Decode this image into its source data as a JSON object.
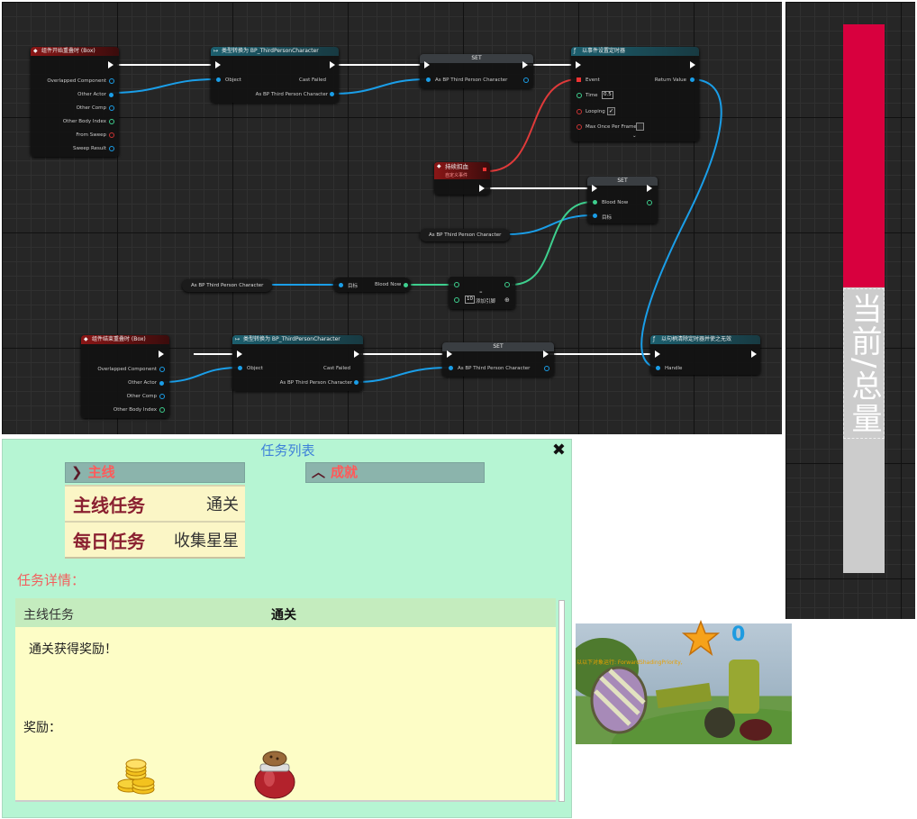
{
  "blueprint": {
    "begin_overlap": {
      "title": "组件开始重叠时 (Box)",
      "pins": [
        "Overlapped Component",
        "Other Actor",
        "Other Comp",
        "Other Body Index",
        "From Sweep",
        "Sweep Result"
      ]
    },
    "cast1": {
      "title": "类型转换为 BP_ThirdPersonCharacter",
      "object": "Object",
      "cast_failed": "Cast Failed",
      "as_bp": "As BP Third Person Character"
    },
    "set1": {
      "title": "SET",
      "pin": "As BP Third Person Character"
    },
    "set_timer": {
      "title": "以事件设置定时器",
      "event": "Event",
      "return_value": "Return Value",
      "time_label": "Time",
      "time_value": "0.5",
      "looping": "Looping",
      "max_once": "Max Once Per Frame",
      "expand": "⌄"
    },
    "custom_event": {
      "title": "持续扣血",
      "subtitle": "自定义事件"
    },
    "set2": {
      "title": "SET",
      "blood_now": "Blood Now",
      "target": "目标"
    },
    "var_right": {
      "label": "As BP Third Person Character"
    },
    "var_left": {
      "label": "As BP Third Person Character"
    },
    "get_blood": {
      "target": "目标",
      "blood_now": "Blood Now"
    },
    "minus": {
      "symbol": "-",
      "value": "10",
      "add_pin": "添加引脚"
    },
    "end_overlap": {
      "title": "组件结束重叠时 (Box)",
      "pins": [
        "Overlapped Component",
        "Other Actor",
        "Other Comp",
        "Other Body Index"
      ]
    },
    "cast2": {
      "title": "类型转换为 BP_ThirdPersonCharacter",
      "object": "Object",
      "cast_failed": "Cast Failed",
      "as_bp": "As BP Third Person Character"
    },
    "set3": {
      "title": "SET",
      "pin": "As BP Third Person Character"
    },
    "clear_timer": {
      "title": "以句柄清除定时器并使之无效",
      "handle": "Handle"
    }
  },
  "health_bar": {
    "label": "当前/总量",
    "fill_fraction": 0.48,
    "fill_color": "#d8003e",
    "empty_color": "#cccccc"
  },
  "quest_panel": {
    "title": "任务列表",
    "close_icon": "✖",
    "tabs": [
      {
        "label": "主线",
        "icon": "chevron-down-icon"
      },
      {
        "label": "成就",
        "icon": "chevron-up-icon"
      }
    ],
    "items": [
      {
        "name": "主线任务",
        "status": "通关"
      },
      {
        "name": "每日任务",
        "status": "收集星星"
      }
    ],
    "detail_label": "任务详情：",
    "detail": {
      "name": "主线任务",
      "status": "通关",
      "description": "通关获得奖励！",
      "rewards_label": "奖励："
    }
  },
  "game_view": {
    "score": "0",
    "warning": "以以下对象运行: ForwardShadingPriority,"
  }
}
